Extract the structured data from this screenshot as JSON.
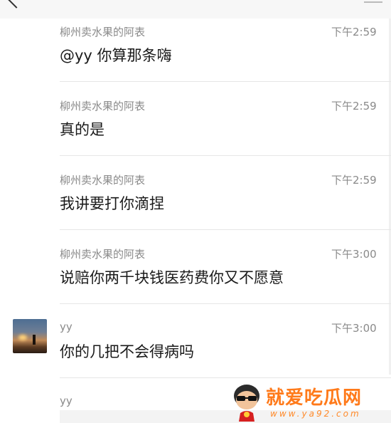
{
  "messages": [
    {
      "sender": "柳州卖水果的阿表",
      "time": "下午2:59",
      "text": "@yy 你算那条嗨"
    },
    {
      "sender": "柳州卖水果的阿表",
      "time": "下午2:59",
      "text": "真的是"
    },
    {
      "sender": "柳州卖水果的阿表",
      "time": "下午2:59",
      "text": "我讲要打你滴捏"
    },
    {
      "sender": "柳州卖水果的阿表",
      "time": "下午3:00",
      "text": "说赔你两千块钱医药费你又不愿意"
    },
    {
      "sender": "yy",
      "time": "下午3:00",
      "text": "你的几把不会得病吗"
    },
    {
      "sender": "yy"
    }
  ],
  "watermark": {
    "title": "就爱吃瓜网",
    "url": "www.ya92.com",
    "colors": {
      "primary": "#ff7a1a"
    }
  },
  "icons": {
    "back": "back-arrow-icon",
    "avatar": "user-avatar"
  }
}
